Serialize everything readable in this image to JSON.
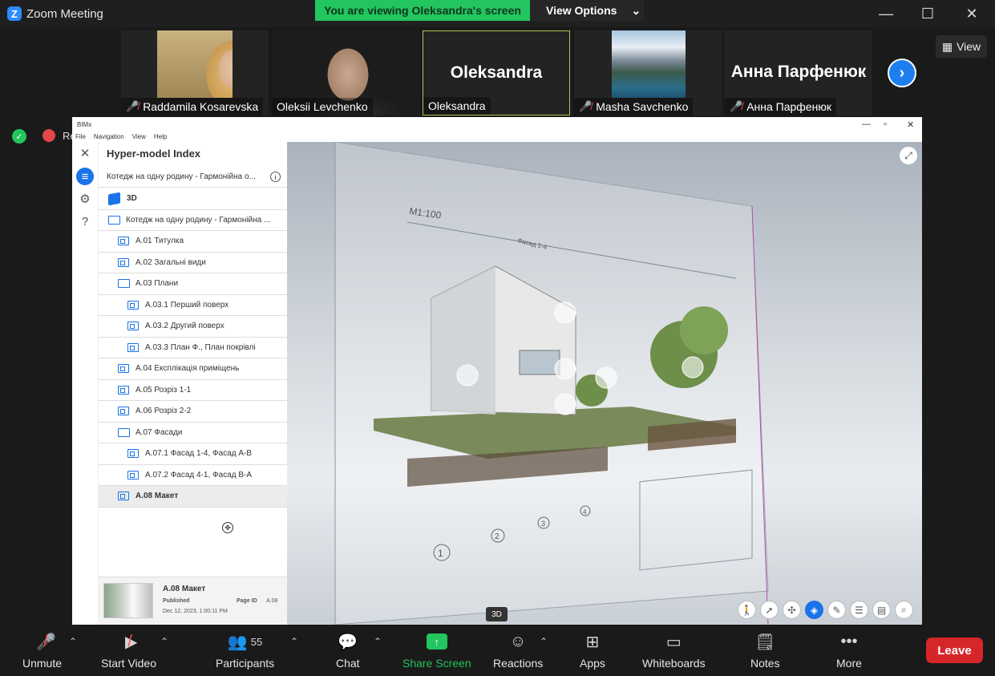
{
  "app": {
    "logo": "Z",
    "title": "Zoom Meeting"
  },
  "banner": {
    "text": "You are viewing Oleksandra's screen",
    "view_options": "View Options"
  },
  "participants": [
    {
      "name": "Raddamila Kosarevska",
      "muted": true
    },
    {
      "name": "Oleksii Levchenko",
      "muted": false
    },
    {
      "name": "Oleksandra",
      "display": "Oleksandra",
      "muted": false
    },
    {
      "name": "Masha Savchenko",
      "muted": true
    },
    {
      "name": "Анна Парфенюк",
      "display": "Анна Парфенюк",
      "muted": true
    }
  ],
  "view_button": "View",
  "rec_text": "Re",
  "shared": {
    "window_title": "BIMx",
    "menu": [
      "File",
      "Navigation",
      "View",
      "Help"
    ],
    "index_title": "Hyper-model Index",
    "project": "Котедж на одну родину - Гармонійна о...",
    "tree": [
      {
        "label": "3D",
        "icon": "3d-icon",
        "indent": 0,
        "bold": true
      },
      {
        "label": "Котедж на одну родину - Гармонійна ...",
        "icon": "folder-icon",
        "indent": 0
      },
      {
        "label": "A.01 Титулка",
        "icon": "page-icon",
        "indent": 1
      },
      {
        "label": "A.02 Загальні види",
        "icon": "page-icon",
        "indent": 1
      },
      {
        "label": "A.03 Плани",
        "icon": "folder-icon",
        "indent": 1
      },
      {
        "label": "A.03.1 Перший поверх",
        "icon": "page-icon",
        "indent": 2
      },
      {
        "label": "A.03.2 Другий поверх",
        "icon": "page-icon",
        "indent": 2
      },
      {
        "label": "A.03.3 План Ф., План покрівлі",
        "icon": "page-icon",
        "indent": 2
      },
      {
        "label": "A.04 Експлікація приміщень",
        "icon": "page-icon",
        "indent": 1
      },
      {
        "label": "A.05 Розріз 1-1",
        "icon": "page-icon",
        "indent": 1
      },
      {
        "label": "A.06 Розріз 2-2",
        "icon": "page-icon",
        "indent": 1
      },
      {
        "label": "A.07 Фасади",
        "icon": "folder-icon",
        "indent": 1
      },
      {
        "label": "A.07.1 Фасад 1-4, Фасад А-В",
        "icon": "page-icon",
        "indent": 2
      },
      {
        "label": "A.07.2 Фасад 4-1, Фасад В-А",
        "icon": "page-icon",
        "indent": 2
      },
      {
        "label": "A.08 Макет",
        "icon": "page-icon",
        "indent": 1,
        "selected": true
      }
    ],
    "footer": {
      "title": "A.08 Макет",
      "status": "Published",
      "date": "Dec 12, 2023, 1:00:11 PM",
      "page_id_label": "Page ID",
      "page_id": "A.08"
    },
    "viewport": {
      "scale_label": "M1:100",
      "facade_label": "Фасад 1-4",
      "axis_labels": [
        "1",
        "2",
        "3",
        "4"
      ],
      "badge": "3D"
    }
  },
  "toolbar": {
    "unmute": "Unmute",
    "start_video": "Start Video",
    "participants": "Participants",
    "participants_count": "55",
    "chat": "Chat",
    "share_screen": "Share Screen",
    "reactions": "Reactions",
    "apps": "Apps",
    "whiteboards": "Whiteboards",
    "notes": "Notes",
    "more": "More",
    "leave": "Leave"
  },
  "colors": {
    "banner_green": "#22c55e",
    "zoom_blue": "#2d8cff",
    "leave_red": "#d7262a",
    "bimx_blue": "#1a73e8"
  }
}
